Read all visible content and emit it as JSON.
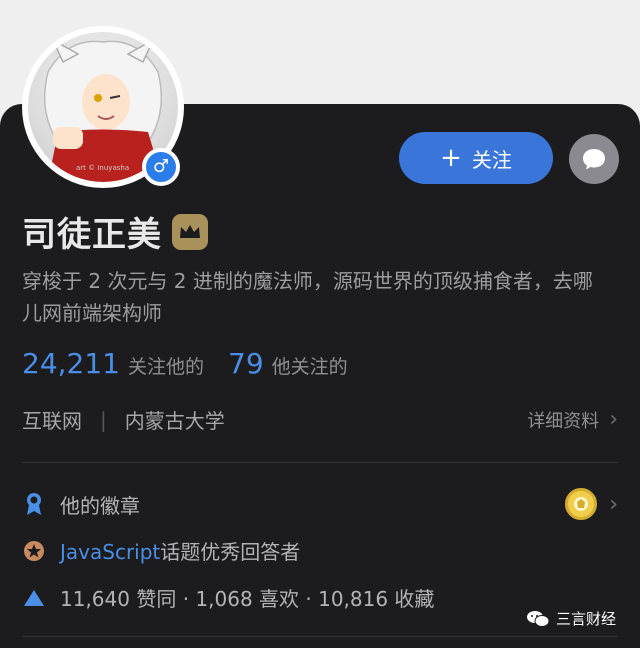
{
  "profile": {
    "name": "司徒正美",
    "gender_symbol": "♂",
    "avatar_caption": "art © Inuyasha",
    "bio": "穿梭于 2 次元与 2 进制的魔法师，源码世界的顶级捕食者，去哪儿网前端架构师"
  },
  "actions": {
    "follow_label": "关注",
    "follow_plus": "+"
  },
  "stats": {
    "followers_count": "24,211",
    "followers_label": "关注他的",
    "following_count": "79",
    "following_label": "他关注的"
  },
  "meta": {
    "industry": "互联网",
    "separator": "|",
    "school": "内蒙古大学",
    "detail_label": "详细资料",
    "chevron": "›"
  },
  "badges": {
    "label": "他的徽章",
    "chevron": "›"
  },
  "topic": {
    "topic_name": "JavaScript",
    "suffix": "话题优秀回答者"
  },
  "achievements": {
    "text": "11,640 赞同 · 1,068 喜欢 · 10,816 收藏"
  },
  "watermark": {
    "text": "三言财经"
  },
  "colors": {
    "accent": "#4a8ee6",
    "follow_button": "#3a76d9",
    "card_background": "#1c1c1e",
    "crown_badge": "#a9915b"
  }
}
